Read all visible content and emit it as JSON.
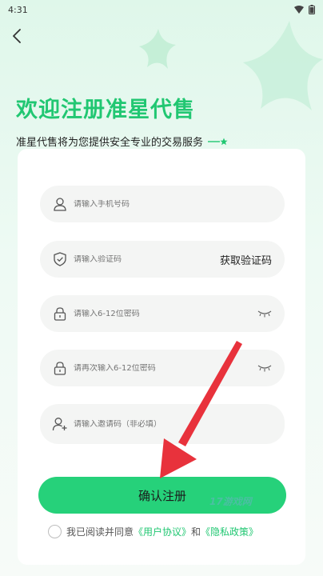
{
  "status_bar": {
    "time": "4:31"
  },
  "header": {
    "title": "欢迎注册准星代售",
    "subtitle": "准星代售将为您提供安全专业的交易服务"
  },
  "form": {
    "phone_placeholder": "请输入手机号码",
    "code_placeholder": "请输入验证码",
    "get_code_label": "获取验证码",
    "password_placeholder": "请输入6-12位密码",
    "password_confirm_placeholder": "请再次输入6-12位密码",
    "invite_placeholder": "请输入邀请码（非必填）"
  },
  "submit_label": "确认注册",
  "agreement": {
    "prefix": "我已阅读并同意",
    "user_agreement": "《用户协议》",
    "and": "和",
    "privacy_policy": "《隐私政策》"
  },
  "watermark": "17游戏网",
  "colors": {
    "accent": "#21c772",
    "button": "#26d17a",
    "annotation_arrow": "#e8323c"
  },
  "icons": [
    "back-arrow-icon",
    "user-icon",
    "shield-icon",
    "lock-icon",
    "eye-closed-icon",
    "add-user-icon"
  ]
}
